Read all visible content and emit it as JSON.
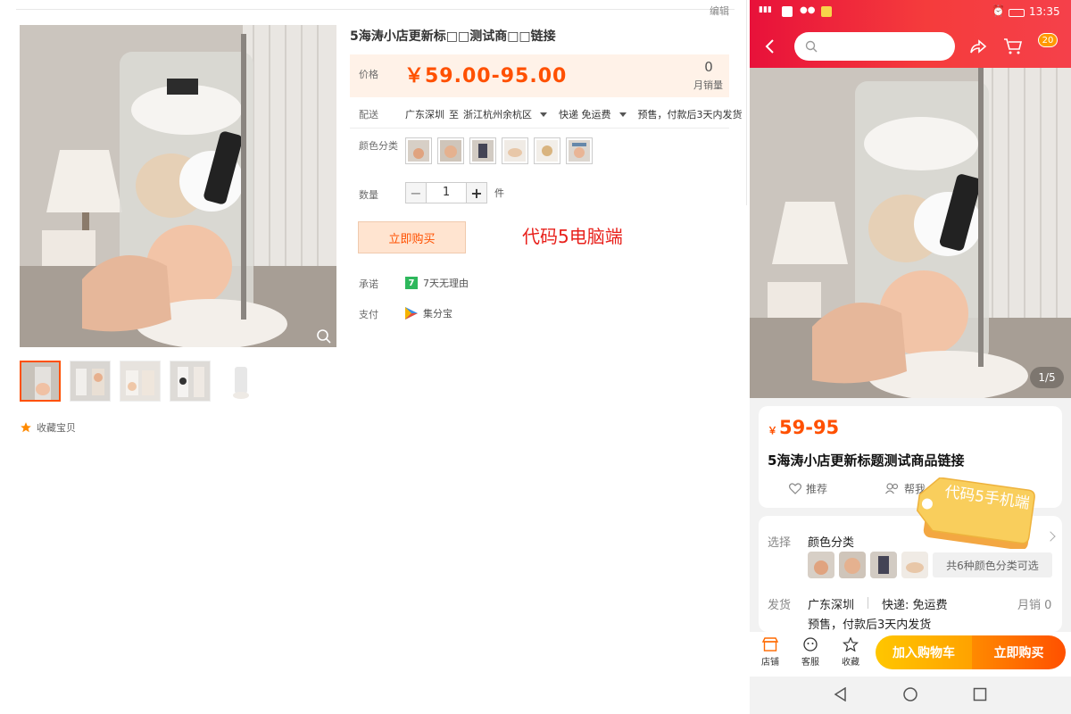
{
  "desktop": {
    "edit_label": "编辑",
    "title": "5海涛小店更新标□□测试商□□链接",
    "price_label": "价格",
    "price": "￥59.00-95.00",
    "monthly_sales_value": "0",
    "monthly_sales_label": "月销量",
    "shipping_label": "配送",
    "ship_from": "广东深圳",
    "ship_to_word": "至",
    "ship_to": "浙江杭州余杭区",
    "express": "快递 免运费",
    "presale": "预售，付款后3天内发货",
    "color_label": "颜色分类",
    "quantity_label": "数量",
    "quantity_value": "1",
    "quantity_unit": "件",
    "buy_now": "立即购买",
    "promise_label": "承诺",
    "promise_icon_text": "7",
    "promise_text": "7天无理由",
    "payment_label": "支付",
    "payment_text": "集分宝",
    "favorite_label": "收藏宝贝",
    "annotation": "代码5电脑端"
  },
  "mobile": {
    "status_time": "13:35",
    "cart_badge": "20",
    "image_pager": "1/5",
    "price_currency": "￥",
    "price": "59-95",
    "title": "5海涛小店更新标题测试商品链接",
    "recommend_label": "推荐",
    "help_label": "帮我",
    "select_label": "选择",
    "color_label": "颜色分类",
    "more_colors": "共6种颜色分类可选",
    "ship_label": "发货",
    "ship_from": "广东深圳",
    "express": "快递: 免运费",
    "monthly_sales": "月销 0",
    "presale": "预售，付款后3天内发货",
    "nav_shop": "店铺",
    "nav_service": "客服",
    "nav_favorite": "收藏",
    "add_to_cart": "加入购物车",
    "buy_now": "立即购买",
    "annotation_tag": "代码5手机端"
  },
  "colors": {
    "accent": "#ff5000",
    "price_band": "#fff2e8",
    "mobile_header": "#e8113a",
    "annotation_red": "#e8201b"
  }
}
